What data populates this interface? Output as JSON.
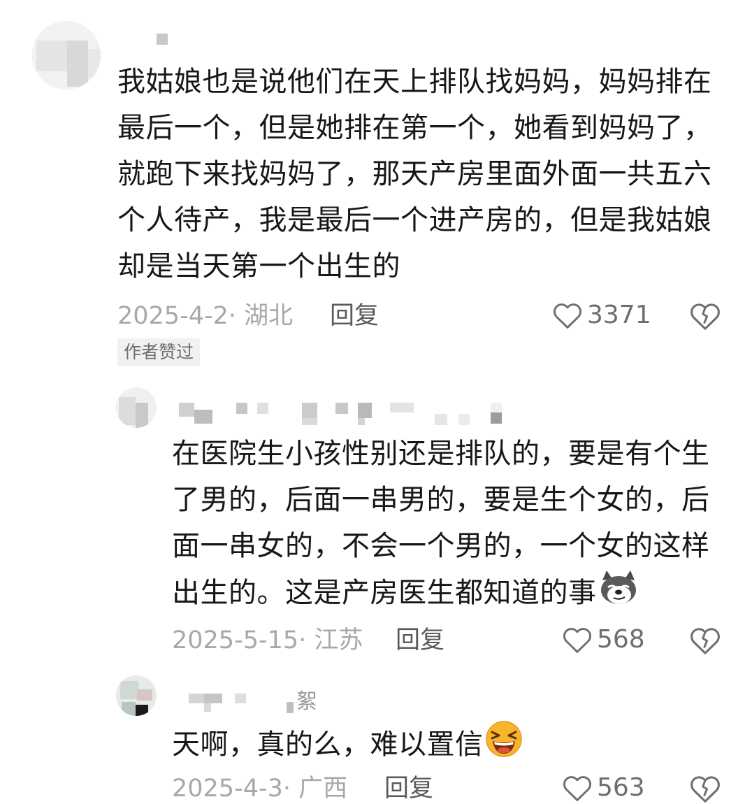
{
  "comments": [
    {
      "text": "我姑娘也是说他们在天上排队找妈妈，妈妈排在最后一个，但是她排在第一个，她看到妈妈了，就跑下来找妈妈了，那天产房里面外面一共五六个人待产，我是最后一个进产房的，但是我姑娘却是当天第一个出生的",
      "date_location": "2025-4-2· 湖北",
      "reply_label": "回复",
      "likes": "3371",
      "badge": "作者赞过"
    },
    {
      "text": "在医院生小孩性别还是排队的，要是有个生了男的，后面一串男的，要是生个女的，后面一串女的，不会一个男的，一个女的这样出生的。这是产房医生都知道的事",
      "emoji": "sly-dog-emoji",
      "date_location": "2025-5-15· 江苏",
      "reply_label": "回复",
      "likes": "568"
    },
    {
      "name_tail": "絮",
      "text": "天啊，真的么，难以置信",
      "emoji": "laughing-emoji",
      "date_location": "2025-4-3· 广西",
      "reply_label": "回复",
      "likes": "563"
    }
  ],
  "icons": {
    "like": "heart-outline-icon",
    "dislike": "broken-heart-icon"
  },
  "colors": {
    "text": "#171717",
    "meta": "#a8a8a8",
    "reply": "#5a5a5a",
    "badge_bg": "#f1f1f1"
  }
}
